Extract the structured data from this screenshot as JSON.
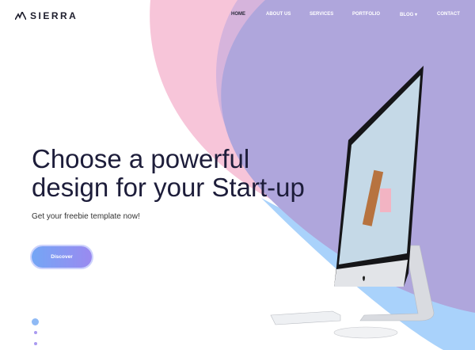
{
  "brand": {
    "name": "SIERRA",
    "icon": "mountain-icon"
  },
  "nav": {
    "items": [
      {
        "label": "HOME",
        "active": true
      },
      {
        "label": "ABOUT US"
      },
      {
        "label": "SERVICES"
      },
      {
        "label": "PORTFOLIO"
      },
      {
        "label": "BLOG",
        "dropdown": true
      },
      {
        "label": "CONTACT"
      }
    ],
    "dropdown_icon": "caret-down-icon"
  },
  "hero": {
    "title_line1": "Choose a powerful",
    "title_line2": "design for your Start-up",
    "subtitle": "Get your freebie template now!",
    "cta_label": "Discover"
  },
  "slider": {
    "dots": 3,
    "active": 0
  },
  "colors": {
    "pink": "#f7c5d9",
    "purple": "#afa6dc",
    "blue": "#a9d2fb",
    "accent_start": "#74a6f5",
    "accent_end": "#9a8af0"
  }
}
